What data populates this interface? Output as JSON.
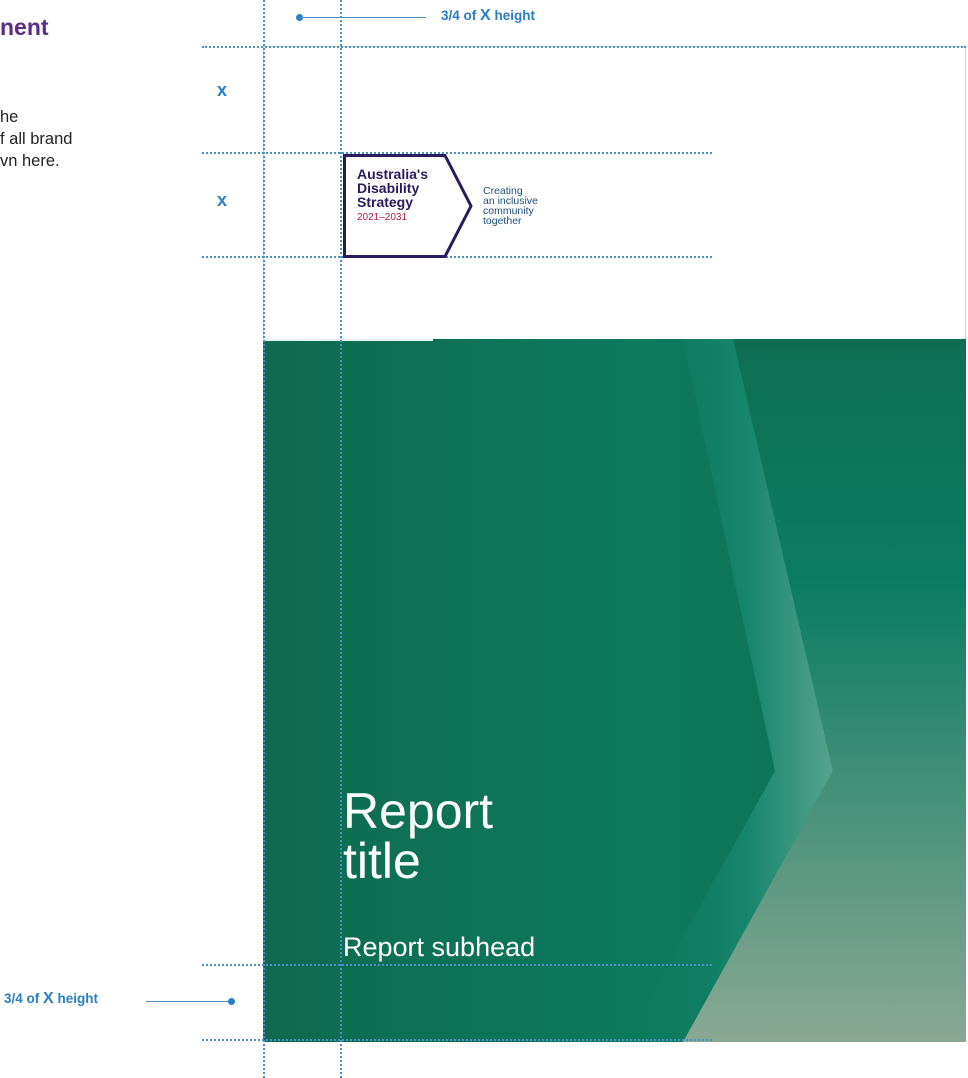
{
  "intro": {
    "heading": "nent",
    "lines": [
      "he",
      "f all brand",
      "vn here."
    ]
  },
  "guides": {
    "top_annotation": {
      "prefix": "3/4 of",
      "x": "X",
      "suffix": "height"
    },
    "bottom_annotation": {
      "prefix": "3/4 of",
      "x": "X",
      "suffix": "height"
    },
    "x_markers": [
      "x",
      "x"
    ]
  },
  "logo": {
    "line1": "Australia's",
    "line2": "Disability",
    "line3": "Strategy",
    "years": "2021–2031",
    "tagline": [
      "Creating",
      "an inclusive",
      "community",
      "together"
    ]
  },
  "cover": {
    "title_lines": [
      "Report",
      "title"
    ],
    "subhead": "Report subhead"
  },
  "colors": {
    "brand_purple": "#5b2c86",
    "guide_blue": "#2a7ec2",
    "cover_green": "#0f6e52"
  }
}
